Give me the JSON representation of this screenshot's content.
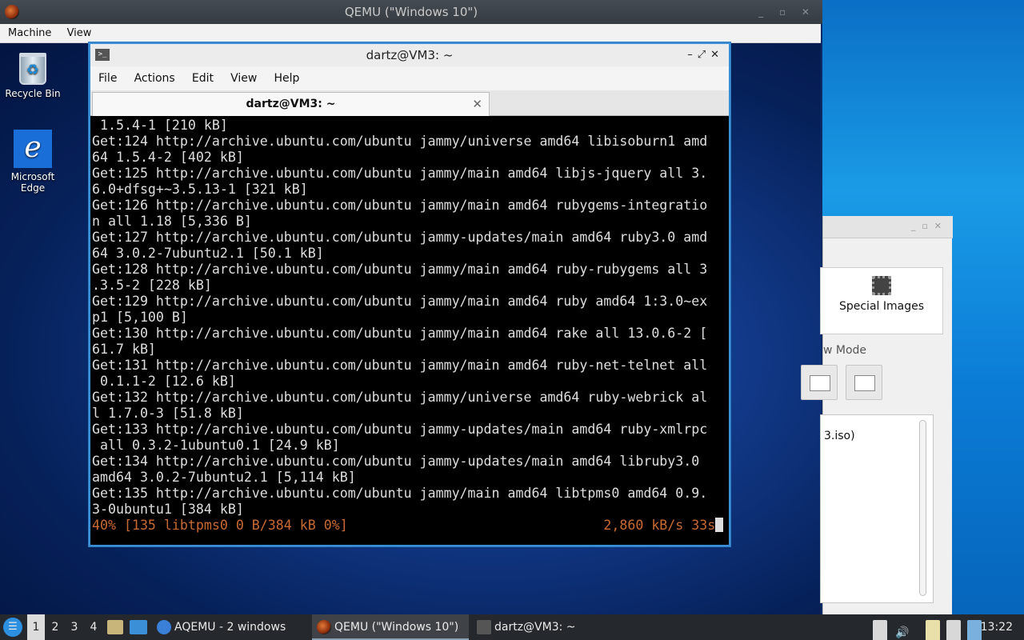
{
  "qemu": {
    "title": "QEMU (\"Windows 10\")",
    "window_buttons": "_ ▫ ✕",
    "menu": [
      "Machine",
      "View"
    ]
  },
  "guest_desktop": {
    "icons": [
      {
        "label": "Recycle Bin",
        "icon": "recycle-bin-icon"
      },
      {
        "label": "Microsoft Edge",
        "icon": "edge-icon"
      }
    ]
  },
  "terminal": {
    "title": "dartz@VM3: ~",
    "menu": [
      "File",
      "Actions",
      "Edit",
      "View",
      "Help"
    ],
    "tab_label": "dartz@VM3: ~",
    "tab_close": "✕",
    "lines": [
      " 1.5.4-1 [210 kB]",
      "Get:124 http://archive.ubuntu.com/ubuntu jammy/universe amd64 libisoburn1 amd",
      "64 1.5.4-2 [402 kB]",
      "Get:125 http://archive.ubuntu.com/ubuntu jammy/main amd64 libjs-jquery all 3.",
      "6.0+dfsg+~3.5.13-1 [321 kB]",
      "Get:126 http://archive.ubuntu.com/ubuntu jammy/main amd64 rubygems-integratio",
      "n all 1.18 [5,336 B]",
      "Get:127 http://archive.ubuntu.com/ubuntu jammy-updates/main amd64 ruby3.0 amd",
      "64 3.0.2-7ubuntu2.1 [50.1 kB]",
      "Get:128 http://archive.ubuntu.com/ubuntu jammy/main amd64 ruby-rubygems all 3",
      ".3.5-2 [228 kB]",
      "Get:129 http://archive.ubuntu.com/ubuntu jammy/main amd64 ruby amd64 1:3.0~ex",
      "p1 [5,100 B]",
      "Get:130 http://archive.ubuntu.com/ubuntu jammy/main amd64 rake all 13.0.6-2 [",
      "61.7 kB]",
      "Get:131 http://archive.ubuntu.com/ubuntu jammy/main amd64 ruby-net-telnet all",
      " 0.1.1-2 [12.6 kB]",
      "Get:132 http://archive.ubuntu.com/ubuntu jammy/universe amd64 ruby-webrick al",
      "l 1.7.0-3 [51.8 kB]",
      "Get:133 http://archive.ubuntu.com/ubuntu jammy-updates/main amd64 ruby-xmlrpc",
      " all 0.3.2-1ubuntu0.1 [24.9 kB]",
      "Get:134 http://archive.ubuntu.com/ubuntu jammy-updates/main amd64 libruby3.0",
      "amd64 3.0.2-7ubuntu2.1 [5,114 kB]",
      "Get:135 http://archive.ubuntu.com/ubuntu jammy/main amd64 libtpms0 amd64 0.9.",
      "3-0ubuntu1 [384 kB]"
    ],
    "progress_line": "40% [135 libtpms0 0 B/384 kB 0%]                                2,860 kB/s 33s",
    "progress_color": "#c86a32"
  },
  "qemu_manager": {
    "special_images_label": "Special Images",
    "view_mode_label": "w Mode",
    "list_item": "3.iso)"
  },
  "taskbar": {
    "workspaces": [
      "1",
      "2",
      "3",
      "4"
    ],
    "active_workspace": "1",
    "tasks": [
      {
        "label": "AQEMU - 2 windows",
        "icon": "aqemu-icon",
        "active": false
      },
      {
        "label": "QEMU (\"Windows 10\")",
        "icon": "qemu-icon",
        "active": true
      },
      {
        "label": "dartz@VM3: ~",
        "icon": "terminal-icon",
        "active": false
      }
    ],
    "clock": "13:22"
  }
}
